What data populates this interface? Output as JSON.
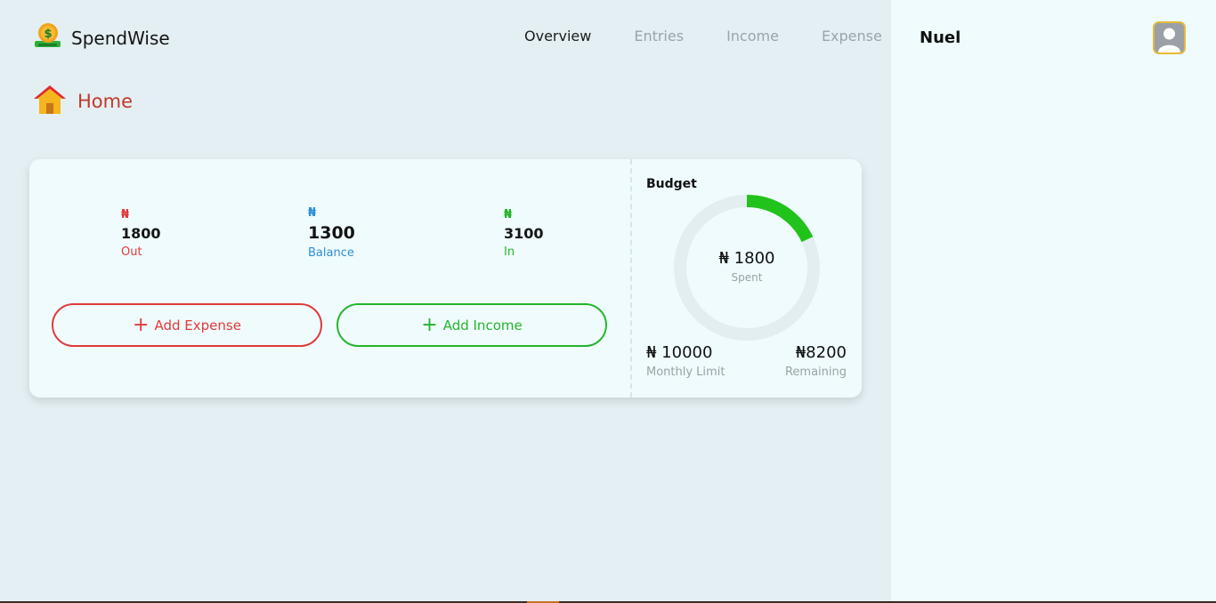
{
  "app": {
    "name": "SpendWise"
  },
  "nav": [
    {
      "label": "Overview",
      "active": true
    },
    {
      "label": "Entries",
      "active": false
    },
    {
      "label": "Income",
      "active": false
    },
    {
      "label": "Expense",
      "active": false
    }
  ],
  "page": {
    "title": "Home"
  },
  "stats": {
    "out": {
      "currency": "₦",
      "amount": "1800",
      "label": "Out"
    },
    "balance": {
      "currency": "₦",
      "amount": "1300",
      "label": "Balance"
    },
    "in": {
      "currency": "₦",
      "amount": "3100",
      "label": "In"
    }
  },
  "actions": {
    "add_expense": "Add Expense",
    "add_income": "Add Income",
    "plus": "+"
  },
  "budget": {
    "title": "Budget",
    "spent_amount": "₦ 1800",
    "spent_label": "Spent",
    "spent_fraction": 0.18,
    "limit_amount": "₦ 10000",
    "limit_label": "Monthly Limit",
    "remaining_amount": "₦8200",
    "remaining_label": "Remaining"
  },
  "user": {
    "name": "Nuel"
  },
  "colors": {
    "expense": "#e03a3a",
    "balance": "#2c8fd6",
    "income": "#25b52b",
    "ring_track": "#e3eef1",
    "ring_fill": "#22c21c",
    "title_accent": "#c0392b"
  }
}
